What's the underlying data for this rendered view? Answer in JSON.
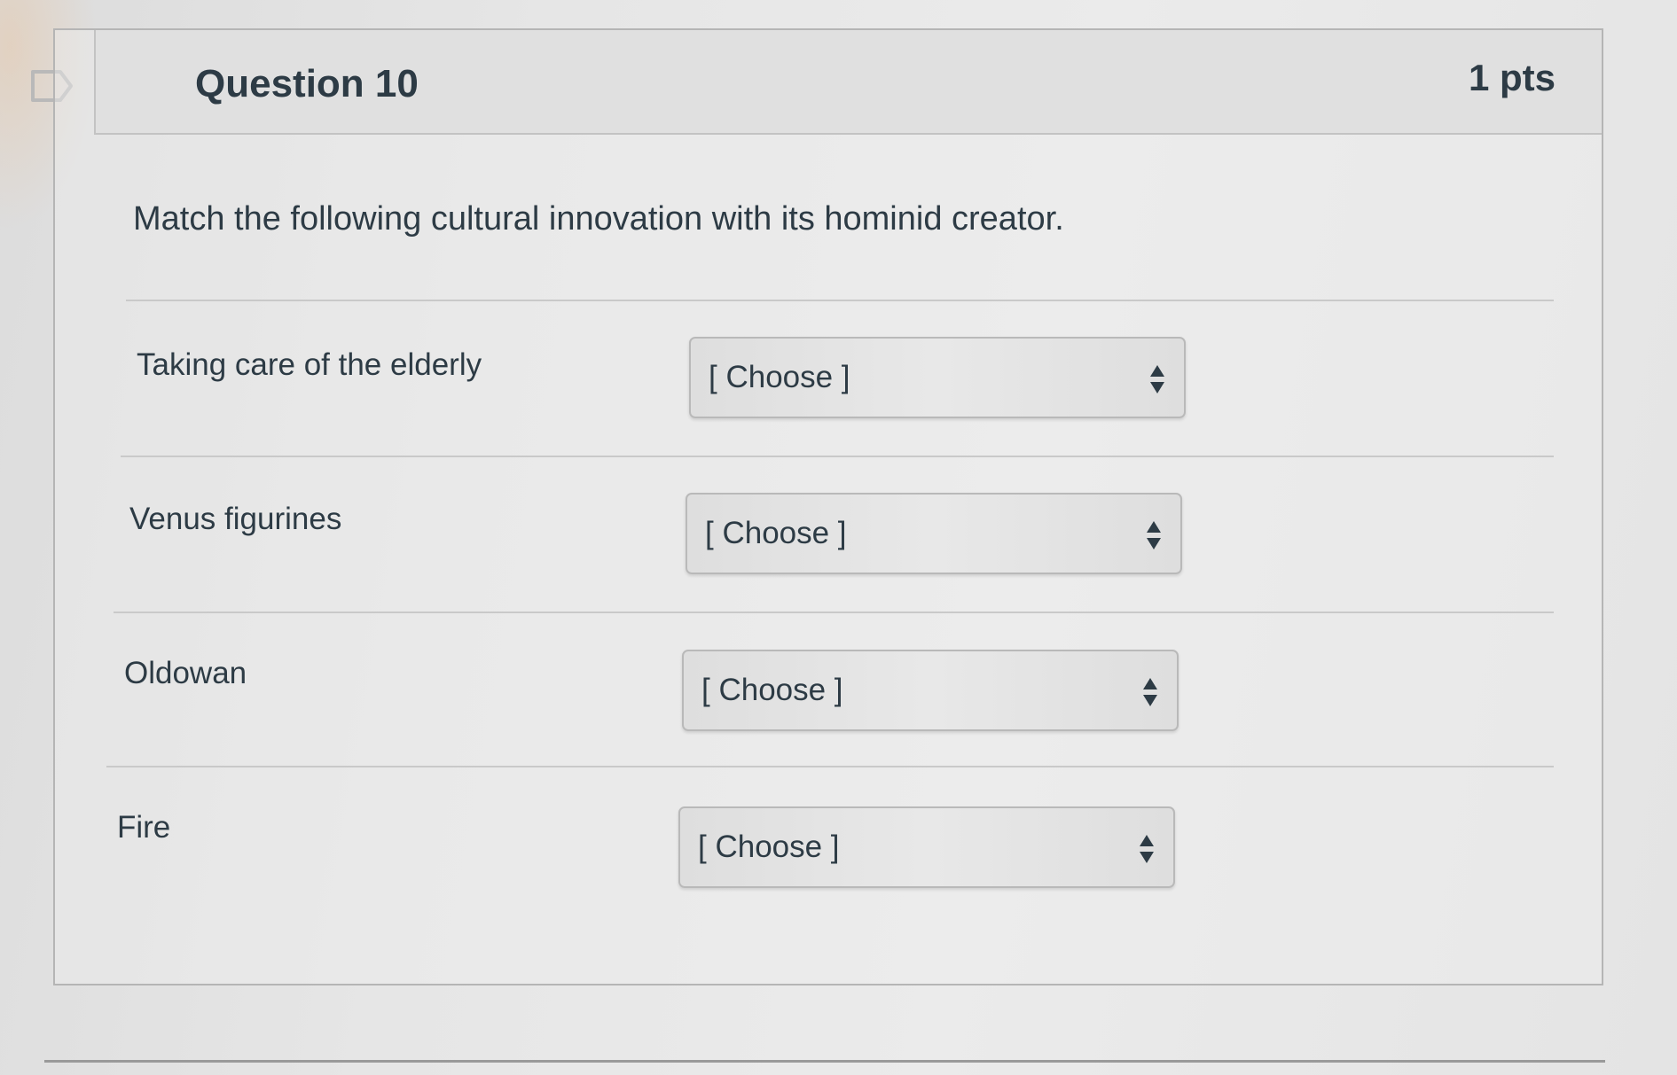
{
  "question": {
    "title": "Question 10",
    "points": "1 pts",
    "prompt": "Match the following cultural innovation with its hominid creator."
  },
  "rows": [
    {
      "label": "Taking care of the elderly",
      "selected": "[ Choose ]"
    },
    {
      "label": "Venus figurines",
      "selected": "[ Choose ]"
    },
    {
      "label": "Oldowan",
      "selected": "[ Choose ]"
    },
    {
      "label": "Fire",
      "selected": "[ Choose ]"
    }
  ],
  "icons": {
    "flag": "bookmark-flag-icon",
    "select_arrows": "up-down-arrows-icon"
  },
  "colors": {
    "text": "#2d3b45",
    "header_bg": "#e0e0e0",
    "border": "#b5b5b5"
  }
}
